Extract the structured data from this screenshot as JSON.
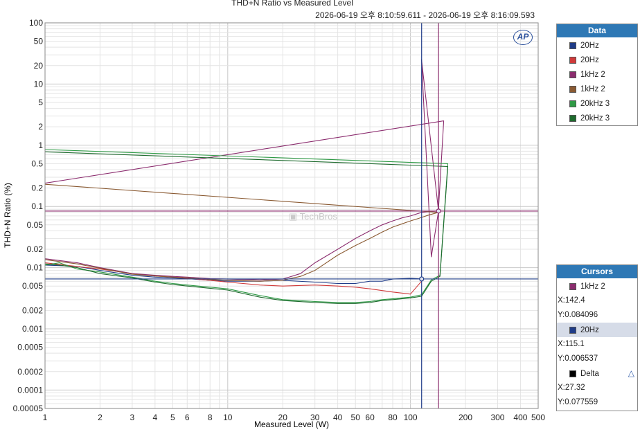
{
  "chart_data": {
    "type": "line",
    "title": "THD+N Ratio vs Measured Level",
    "subtitle": "2026-06-19 오후 8:10:59.611 - 2026-06-19 오후 8:16:09.593",
    "xlabel": "Measured Level (W)",
    "ylabel": "THD+N Ratio (%)",
    "xscale": "log",
    "yscale": "log",
    "xlim": [
      1,
      500
    ],
    "ylim": [
      5e-05,
      100
    ],
    "grid": true,
    "legend_position": "right",
    "x_ticks": [
      1,
      2,
      3,
      4,
      5,
      6,
      8,
      10,
      20,
      30,
      40,
      50,
      60,
      80,
      100,
      200,
      300,
      400,
      500
    ],
    "x_tick_labels": [
      "1",
      "2",
      "3",
      "4",
      "5",
      "6",
      "8",
      "10",
      "20",
      "30",
      "40",
      "50",
      "60",
      "80",
      "100",
      "200",
      "300",
      "400",
      "500"
    ],
    "y_ticks": [
      100,
      50,
      20,
      10,
      5,
      2,
      1,
      0.5,
      0.2,
      0.1,
      0.05,
      0.02,
      0.01,
      0.005,
      0.002,
      0.001,
      0.0005,
      0.0002,
      0.0001,
      5e-05
    ],
    "y_tick_labels": [
      "100",
      "50",
      "20",
      "10",
      "5",
      "2",
      "1",
      "0.5",
      "0.2",
      "0.1",
      "0.05",
      "0.02",
      "0.01",
      "0.005",
      "0.002",
      "0.001",
      "0.0005",
      "0.0002",
      "0.0001",
      "0.00005"
    ],
    "series": [
      {
        "name": "20Hz",
        "color": "#1f3c88",
        "x": [
          1,
          1.5,
          2,
          3,
          4,
          5,
          6,
          8,
          10,
          15,
          20,
          30,
          40,
          50,
          60,
          70,
          80,
          90,
          100,
          115.1
        ],
        "y": [
          0.011,
          0.0105,
          0.009,
          0.0075,
          0.007,
          0.0068,
          0.0066,
          0.0062,
          0.006,
          0.006,
          0.0062,
          0.0058,
          0.0055,
          0.0055,
          0.006,
          0.006,
          0.0065,
          0.0066,
          0.0067,
          0.006537
        ]
      },
      {
        "name": "20Hz",
        "color": "#d03a3a",
        "x": [
          1,
          2,
          3,
          4,
          5,
          8,
          10,
          15,
          20,
          30,
          40,
          50,
          60,
          80,
          100,
          115
        ],
        "y": [
          0.012,
          0.0095,
          0.008,
          0.0073,
          0.007,
          0.0062,
          0.0058,
          0.0052,
          0.005,
          0.0052,
          0.005,
          0.0048,
          0.0045,
          0.004,
          0.0037,
          0.006
        ]
      },
      {
        "name": "1kHz 2",
        "color": "#8b2c6e",
        "x": [
          1,
          1.5,
          2,
          3,
          4,
          5,
          6,
          8,
          10,
          15,
          20,
          25,
          30,
          40,
          50,
          60,
          70,
          80,
          90,
          100,
          115,
          125,
          142.4,
          115,
          130,
          142,
          152,
          1
        ],
        "y": [
          0.014,
          0.012,
          0.01,
          0.008,
          0.0075,
          0.0072,
          0.007,
          0.0066,
          0.0065,
          0.0063,
          0.0065,
          0.008,
          0.012,
          0.02,
          0.03,
          0.04,
          0.05,
          0.058,
          0.065,
          0.07,
          0.08,
          0.082,
          0.084096,
          25,
          0.015,
          0.08,
          2.5,
          0.24
        ]
      },
      {
        "name": "1kHz 2",
        "color": "#8a5a32",
        "x": [
          1,
          1.5,
          2,
          3,
          4,
          5,
          6,
          8,
          10,
          15,
          20,
          25,
          30,
          40,
          50,
          60,
          70,
          80,
          90,
          100,
          115,
          125,
          142,
          1
        ],
        "y": [
          0.0135,
          0.0115,
          0.0098,
          0.0078,
          0.0073,
          0.007,
          0.0068,
          0.0064,
          0.0062,
          0.006,
          0.0062,
          0.0072,
          0.009,
          0.016,
          0.023,
          0.03,
          0.038,
          0.046,
          0.052,
          0.058,
          0.066,
          0.072,
          0.08,
          0.23
        ]
      },
      {
        "name": "20kHz 3",
        "color": "#2e9a45",
        "x": [
          1,
          1.2,
          1.5,
          2,
          3,
          4,
          5,
          6,
          8,
          10,
          15,
          20,
          30,
          40,
          50,
          60,
          70,
          80,
          100,
          115,
          130,
          145,
          160,
          1
        ],
        "y": [
          0.011,
          0.012,
          0.0095,
          0.0085,
          0.007,
          0.006,
          0.0055,
          0.0052,
          0.0048,
          0.0045,
          0.0035,
          0.003,
          0.0028,
          0.0027,
          0.0027,
          0.0028,
          0.003,
          0.0031,
          0.0033,
          0.0036,
          0.0063,
          0.0075,
          0.5,
          0.85
        ]
      },
      {
        "name": "20kHz 3",
        "color": "#1e6b2e",
        "x": [
          1,
          1.2,
          1.5,
          2,
          3,
          4,
          5,
          6,
          8,
          10,
          15,
          20,
          30,
          40,
          50,
          60,
          70,
          80,
          100,
          115,
          130,
          145,
          160,
          1
        ],
        "y": [
          0.0115,
          0.011,
          0.01,
          0.008,
          0.0068,
          0.0058,
          0.0053,
          0.005,
          0.0046,
          0.0043,
          0.0033,
          0.0029,
          0.0027,
          0.0026,
          0.0026,
          0.0027,
          0.0029,
          0.003,
          0.0032,
          0.0034,
          0.006,
          0.0072,
          0.45,
          0.78
        ]
      }
    ],
    "cursors": [
      {
        "name": "1kHz 2",
        "color": "#8b2c6e",
        "x": 142.4,
        "y": 0.084096
      },
      {
        "name": "20Hz",
        "color": "#1f3c88",
        "x": 115.1,
        "y": 0.006537
      }
    ]
  },
  "data_panel": {
    "header": "Data",
    "items": [
      {
        "label": "20Hz",
        "color": "#1f3c88"
      },
      {
        "label": "20Hz",
        "color": "#d03a3a"
      },
      {
        "label": "1kHz 2",
        "color": "#8b2c6e"
      },
      {
        "label": "1kHz 2",
        "color": "#8a5a32"
      },
      {
        "label": "20kHz 3",
        "color": "#2e9a45"
      },
      {
        "label": "20kHz 3",
        "color": "#1e6b2e"
      }
    ]
  },
  "cursor_panel": {
    "header": "Cursors",
    "c1": {
      "label": "1kHz 2",
      "color": "#8b2c6e",
      "x": "X:142.4",
      "y": "Y:0.084096"
    },
    "c2": {
      "label": "20Hz",
      "color": "#1f3c88",
      "x": "X:115.1",
      "y": "Y:0.006537"
    },
    "delta": {
      "label": "Delta",
      "color": "#000000",
      "x": "X:27.32",
      "y": "Y:0.077559"
    }
  },
  "logo_text": "AP",
  "watermark": "TechBros"
}
